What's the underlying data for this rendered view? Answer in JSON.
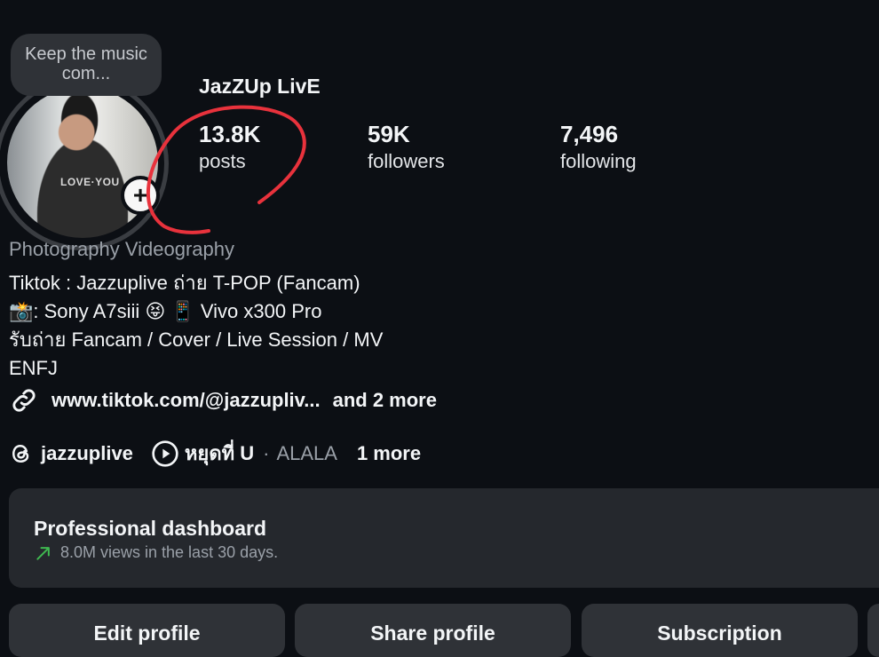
{
  "profile": {
    "note": "Keep the music com...",
    "username": "JazZUp LivE",
    "add_icon": "plus-icon"
  },
  "stats": [
    {
      "value": "13.8K",
      "label": "posts"
    },
    {
      "value": "59K",
      "label": "followers"
    },
    {
      "value": "7,496",
      "label": "following"
    }
  ],
  "bio": {
    "category": "Photography Videography",
    "lines": [
      "Tiktok : Jazzuplive ถ่าย T-POP (Fancam)",
      "📸: Sony A7siii 😝 📱 Vivo x300 Pro",
      "รับถ่าย Fancam / Cover / Live Session / MV",
      "ENFJ"
    ]
  },
  "links": {
    "icon": "link-icon",
    "url": "www.tiktok.com/@jazzupliv...",
    "more": "and 2 more"
  },
  "social": {
    "threads_icon": "threads-icon",
    "threads_handle": "jazzuplive",
    "music_icon": "play-icon",
    "song": "หยุดที่ U",
    "separator": "·",
    "artist": "ALALA",
    "more": "1 more"
  },
  "dashboard": {
    "title": "Professional dashboard",
    "trend_icon": "trend-up-arrow-icon",
    "subtitle": "8.0M views in the last 30 days."
  },
  "buttons": {
    "edit": "Edit profile",
    "share": "Share profile",
    "subscription": "Subscription"
  },
  "colors": {
    "background": "#0c0f14",
    "card": "#25282d",
    "button": "#2f3237",
    "annotation": "#e8323c",
    "trend": "#3fb950"
  }
}
